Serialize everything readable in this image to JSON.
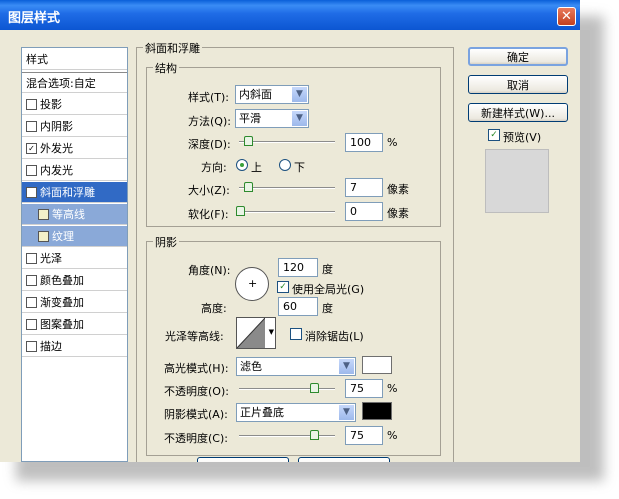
{
  "window": {
    "title": "图层样式",
    "close_glyph": "✕"
  },
  "style_list": {
    "header": "样式",
    "blend_options": "混合选项:自定",
    "items": [
      {
        "label": "投影",
        "checked": false,
        "glyph": ""
      },
      {
        "label": "内阴影",
        "checked": false,
        "glyph": ""
      },
      {
        "label": "外发光",
        "checked": true,
        "glyph": "✓"
      },
      {
        "label": "内发光",
        "checked": false,
        "glyph": ""
      },
      {
        "label": "斜面和浮雕",
        "checked": true,
        "glyph": "✓",
        "selected": true
      },
      {
        "label": "等高线",
        "checked": false,
        "glyph": "",
        "sub": true
      },
      {
        "label": "纹理",
        "checked": false,
        "glyph": "",
        "sub": true
      },
      {
        "label": "光泽",
        "checked": false,
        "glyph": ""
      },
      {
        "label": "颜色叠加",
        "checked": false,
        "glyph": ""
      },
      {
        "label": "渐变叠加",
        "checked": false,
        "glyph": ""
      },
      {
        "label": "图案叠加",
        "checked": false,
        "glyph": ""
      },
      {
        "label": "描边",
        "checked": false,
        "glyph": ""
      }
    ]
  },
  "bevel": {
    "section_title": "斜面和浮雕",
    "structure": {
      "title": "结构",
      "style_label": "样式(T):",
      "style_value": "内斜面",
      "technique_label": "方法(Q):",
      "technique_value": "平滑",
      "depth_label": "深度(D):",
      "depth_value": "100",
      "depth_unit": "%",
      "direction_label": "方向:",
      "direction_up": "上",
      "direction_down": "下",
      "size_label": "大小(Z):",
      "size_value": "7",
      "size_unit": "像素",
      "soften_label": "软化(F):",
      "soften_value": "0",
      "soften_unit": "像素"
    },
    "shading": {
      "title": "阴影",
      "angle_label": "角度(N):",
      "angle_value": "120",
      "angle_unit": "度",
      "global_light_label": "使用全局光(G)",
      "global_light_glyph": "✓",
      "altitude_label": "高度:",
      "altitude_value": "60",
      "altitude_unit": "度",
      "gloss_contour_label": "光泽等高线:",
      "antialias_label": "消除锯齿(L)",
      "highlight_mode_label": "高光模式(H):",
      "highlight_mode_value": "滤色",
      "highlight_opacity_label": "不透明度(O):",
      "highlight_opacity_value": "75",
      "highlight_opacity_unit": "%",
      "shadow_mode_label": "阴影模式(A):",
      "shadow_mode_value": "正片叠底",
      "shadow_opacity_label": "不透明度(C):",
      "shadow_opacity_value": "75",
      "shadow_opacity_unit": "%",
      "highlight_color": "#ffffff",
      "shadow_color": "#000000"
    }
  },
  "buttons": {
    "ok": "确定",
    "cancel": "取消",
    "new_style": "新建样式(W)...",
    "preview_label": "预览(V)",
    "preview_glyph": "✓"
  },
  "icons": {
    "dropdown_arrow": "▼",
    "crosshair": "+"
  }
}
